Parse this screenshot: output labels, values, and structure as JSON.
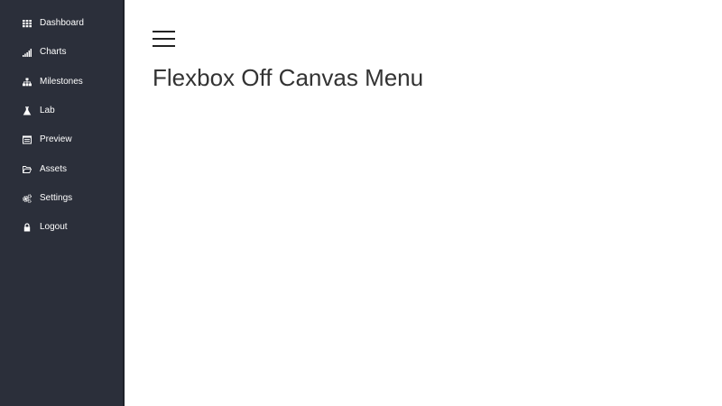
{
  "sidebar": {
    "items": [
      {
        "label": "Dashboard",
        "icon": "grid-icon"
      },
      {
        "label": "Charts",
        "icon": "signal-bars-icon"
      },
      {
        "label": "Milestones",
        "icon": "sitemap-icon"
      },
      {
        "label": "Lab",
        "icon": "flask-icon"
      },
      {
        "label": "Preview",
        "icon": "list-alt-icon"
      },
      {
        "label": "Assets",
        "icon": "folder-open-icon"
      },
      {
        "label": "Settings",
        "icon": "cogs-icon"
      },
      {
        "label": "Logout",
        "icon": "lock-icon"
      }
    ]
  },
  "main": {
    "menu_toggle": "hamburger-menu-icon",
    "title": "Flexbox Off Canvas Menu"
  },
  "colors": {
    "sidebar_bg": "#2b2f3a",
    "sidebar_text": "#ffffff",
    "title_text": "#333333"
  }
}
